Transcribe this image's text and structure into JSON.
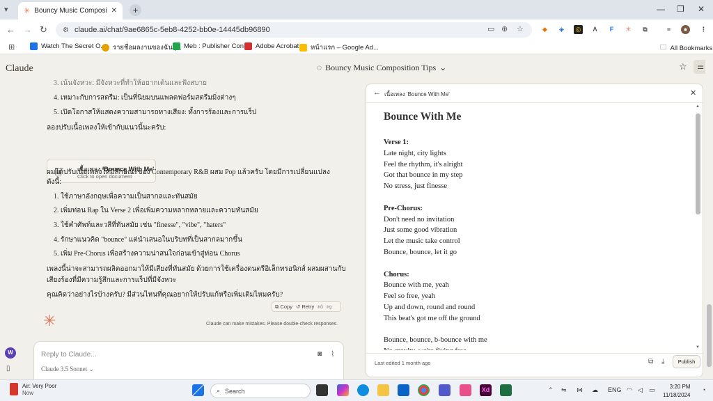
{
  "browser": {
    "tab_title": "Bouncy Music Composition Tip",
    "url": "claude.ai/chat/9ae6865c-5eb8-4252-bb0e-14445db96890",
    "bookmarks": [
      {
        "label": "Watch The Secret O...",
        "color": "#1a73e8"
      },
      {
        "label": "รายชื่อผลงานของฉัน |...",
        "color": "#e6a100"
      },
      {
        "label": "Meb : Publisher Con...",
        "color": "#1fa64a"
      },
      {
        "label": "Adobe Acrobat",
        "color": "#d32f2f"
      },
      {
        "label": "หน้าแรก – Google Ad...",
        "color": "#fbbc04"
      }
    ],
    "all_bookmarks": "All Bookmarks"
  },
  "app": {
    "brand": "Claude",
    "conversation_title": "Bouncy Music Composition Tips"
  },
  "chat": {
    "lines_top": [
      "3. เน้นจังหวะ: มีจังหวะที่ทำให้อยากเต้นและฟังสบาย",
      "4. เหมาะกับการสตรีม: เป็นที่นิยมบนแพลตฟอร์มสตรีมมิ่งต่างๆ",
      "5. เปิดโอกาสให้แสดงความสามารถทางเสียง: ทั้งการร้องและการแร็ป",
      "ลองปรับเนื้อเพลงให้เข้ากับแนวนี้นะครับ:"
    ],
    "doc_card": {
      "title_prefix": "เนื้อเพลง ",
      "title_bold": "'Bounce With Me'",
      "subtitle": "Click to open document"
    },
    "lines_bottom": [
      "ผมได้ปรับเนื้อเพลงให้มีลักษณะของ Contemporary R&B ผสม Pop แล้วครับ โดยมีการเปลี่ยนแปลง",
      "ดังนี้:",
      "1. ใช้ภาษาอังกฤษเพื่อความเป็นสากลและทันสมัย",
      "2. เพิ่มท่อน Rap ใน Verse 2 เพื่อเพิ่มความหลากหลายและความทันสมัย",
      "3. ใช้คำศัพท์และวลีที่ทันสมัย เช่น \"finesse\", \"vibe\", \"haters\"",
      "4. รักษาแนวคิด \"bounce\" แต่นำเสนอในบริบทที่เป็นสากลมากขึ้น",
      "5. เพิ่ม Pre-Chorus เพื่อสร้างความน่าสนใจก่อนเข้าสู่ท่อน Chorus",
      "เพลงนี้น่าจะสามารถผลิตออกมาให้มีเสียงที่ทันสมัย ด้วยการใช้เครื่องดนตรีอิเล็กทรอนิกส์ ผสมผสานกับ",
      "เสียงร้องที่มีความรู้สึกและการแร็ปที่มีจังหวะ",
      "คุณคิดว่าอย่างไรบ้างครับ? มีส่วนไหนที่คุณอยากให้ปรับแก้หรือเพิ่มเติมไหมครับ?"
    ],
    "actions": {
      "copy": "Copy",
      "retry": "Retry"
    },
    "disclaimer": "Claude can make mistakes. Please double-check responses.",
    "input_placeholder": "Reply to Claude...",
    "model": "Claude 3.5 Sonnet",
    "user_initial": "W"
  },
  "artifact": {
    "panel_title": "เนื้อเพลง 'Bounce With Me'",
    "heading": "Bounce With Me",
    "lines": [
      {
        "text": "Verse 1:",
        "bold": true
      },
      {
        "text": "Late night, city lights",
        "bold": false
      },
      {
        "text": "Feel the rhythm, it's alright",
        "bold": false
      },
      {
        "text": "Got that bounce in my step",
        "bold": false
      },
      {
        "text": "No stress, just finesse",
        "bold": false
      },
      {
        "text": "",
        "bold": false
      },
      {
        "text": "Pre-Chorus:",
        "bold": true
      },
      {
        "text": "Don't need no invitation",
        "bold": false
      },
      {
        "text": "Just some good vibration",
        "bold": false
      },
      {
        "text": "Let the music take control",
        "bold": false
      },
      {
        "text": "Bounce, bounce, let it go",
        "bold": false
      },
      {
        "text": "",
        "bold": false
      },
      {
        "text": "Chorus:",
        "bold": true
      },
      {
        "text": "Bounce with me, yeah",
        "bold": false
      },
      {
        "text": "Feel so free, yeah",
        "bold": false
      },
      {
        "text": "Up and down, round and round",
        "bold": false
      },
      {
        "text": "This beat's got me off the ground",
        "bold": false
      },
      {
        "text": "",
        "bold": false
      },
      {
        "text": "Bounce, bounce, b-bounce with me",
        "bold": false
      },
      {
        "text": "No gravity, we're flying free",
        "bold": false
      }
    ],
    "last_edited": "Last edited 1 month ago",
    "publish": "Publish"
  },
  "taskbar": {
    "weather_title": "Air: Very Poor",
    "weather_sub": "Now",
    "search": "Search",
    "lang": "ENG",
    "time": "3:20 PM",
    "date": "11/18/2024"
  }
}
